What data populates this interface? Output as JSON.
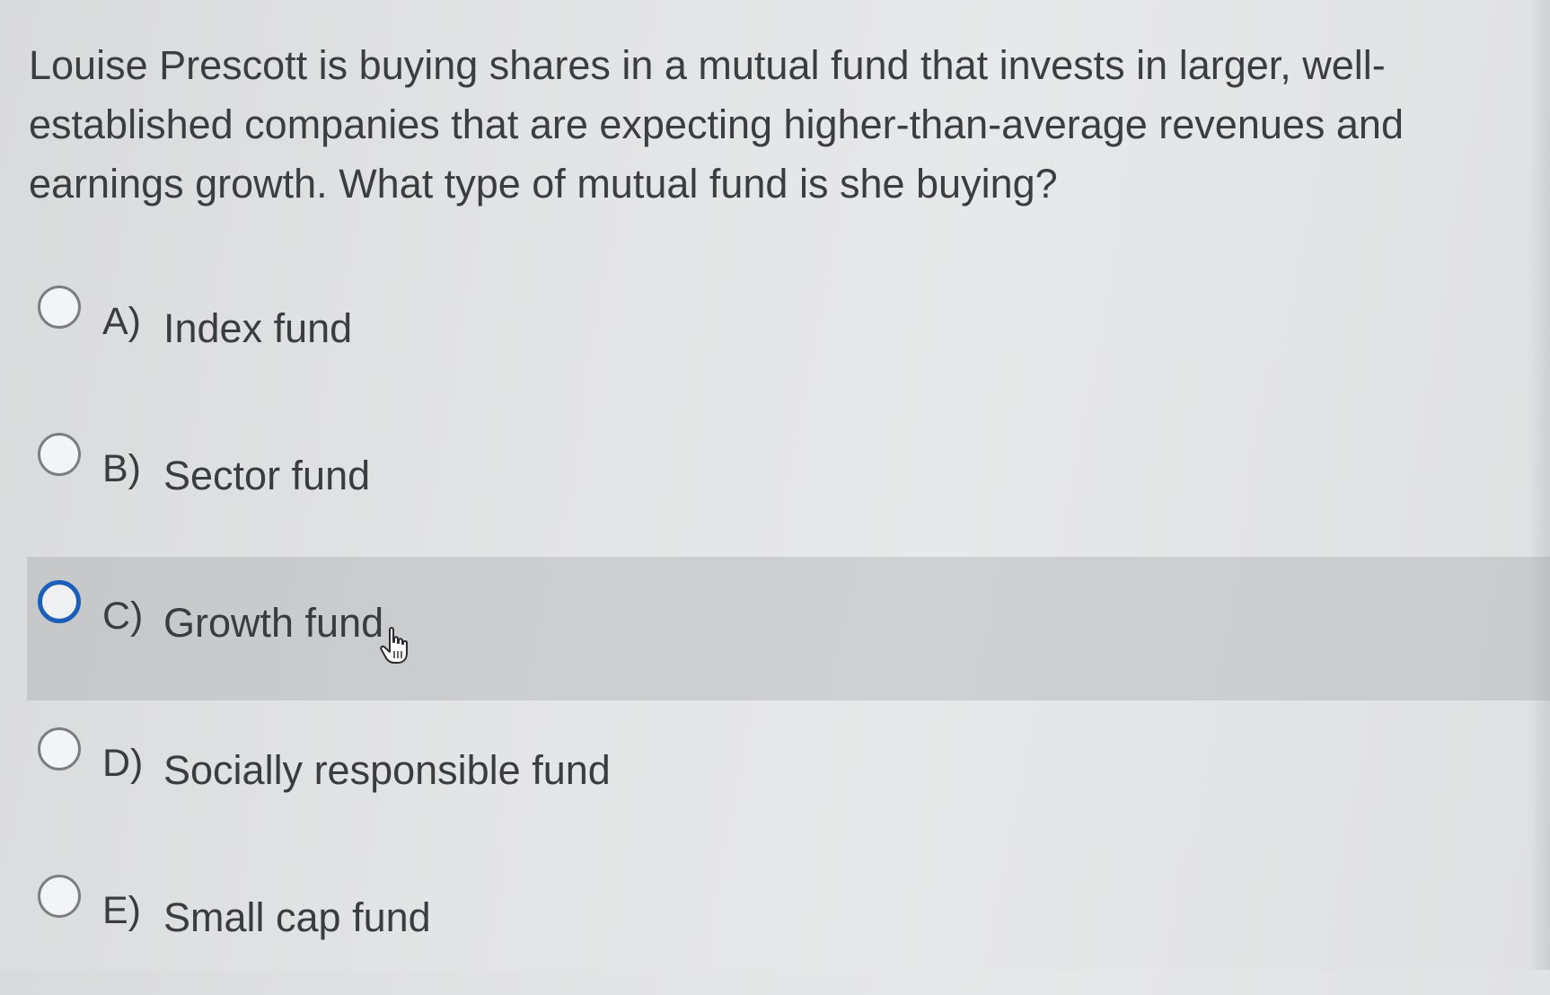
{
  "question": {
    "text": "Louise Prescott is buying shares in a mutual fund that invests in larger, well-established companies that are expecting higher-than-average revenues and earnings growth. What type of mutual fund is she buying?"
  },
  "options": [
    {
      "letter": "A)",
      "text": "Index fund"
    },
    {
      "letter": "B)",
      "text": "Sector fund"
    },
    {
      "letter": "C)",
      "text": "Growth fund"
    },
    {
      "letter": "D)",
      "text": "Socially responsible fund"
    },
    {
      "letter": "E)",
      "text": "Small cap fund"
    }
  ],
  "hovered_option": "C)",
  "colors": {
    "radio_hover_border": "#1b5fb8",
    "radio_border": "#7b7e81",
    "text": "#3a3d40"
  },
  "icons": {
    "cursor": "hand-pointer-icon"
  }
}
